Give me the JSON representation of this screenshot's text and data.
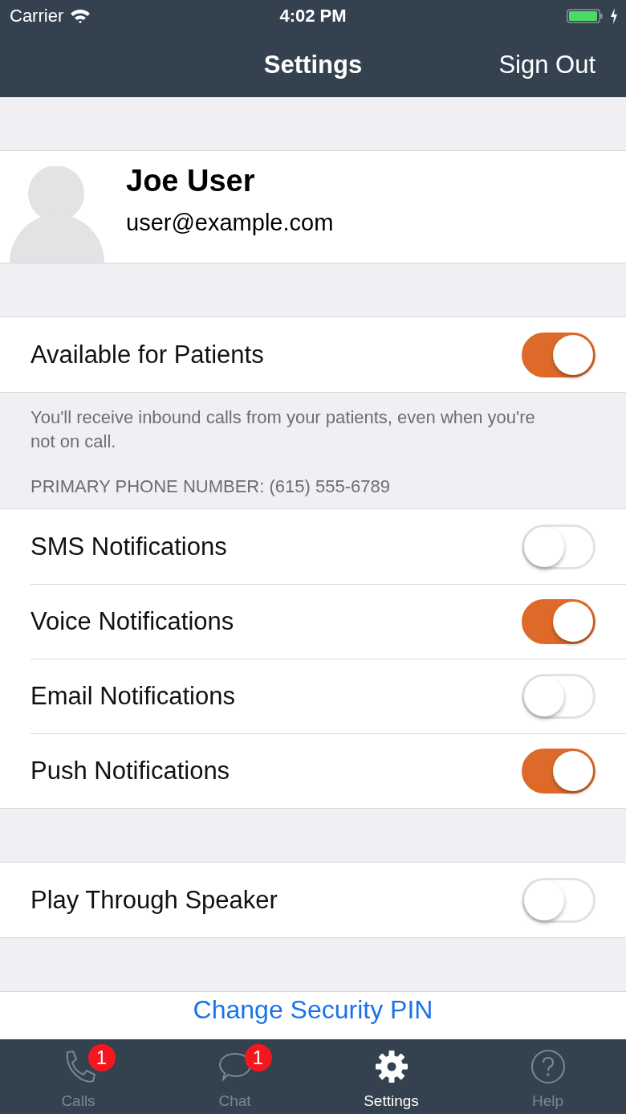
{
  "status_bar": {
    "carrier": "Carrier",
    "time": "4:02 PM"
  },
  "nav_bar": {
    "title": "Settings",
    "action": "Sign Out"
  },
  "profile": {
    "name": "Joe User",
    "email": "user@example.com"
  },
  "availability": {
    "label": "Available for Patients",
    "on": true,
    "footer": "You'll receive inbound calls from your patients, even when you're not on call."
  },
  "notifications": {
    "header": "PRIMARY PHONE NUMBER: (615) 555-6789",
    "items": [
      {
        "label": "SMS Notifications",
        "on": false
      },
      {
        "label": "Voice Notifications",
        "on": true
      },
      {
        "label": "Email Notifications",
        "on": false
      },
      {
        "label": "Push Notifications",
        "on": true
      }
    ]
  },
  "speaker": {
    "label": "Play Through Speaker",
    "on": false
  },
  "security": {
    "link": "Change Security PIN"
  },
  "tab_bar": [
    {
      "kind": "phone",
      "label": "Calls",
      "badge": "1",
      "selected": false
    },
    {
      "kind": "chat",
      "label": "Chat",
      "badge": "1",
      "selected": false
    },
    {
      "kind": "gear",
      "label": "Settings",
      "selected": true
    },
    {
      "kind": "help",
      "label": "Help",
      "selected": false
    }
  ]
}
